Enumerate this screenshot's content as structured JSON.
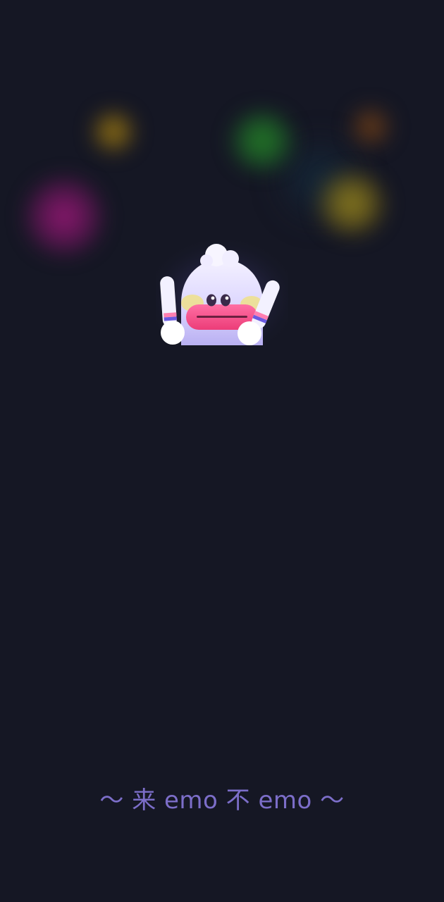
{
  "splash": {
    "tagline": "～ 来 emo 不 emo ～",
    "mascot_icon": "ghost-mascot-icon",
    "background_color": "#151724",
    "tagline_color": "#7c6ec9",
    "orb_colors": [
      "#be9614",
      "#289628",
      "#965014",
      "#aa961e",
      "#aa1982"
    ]
  }
}
